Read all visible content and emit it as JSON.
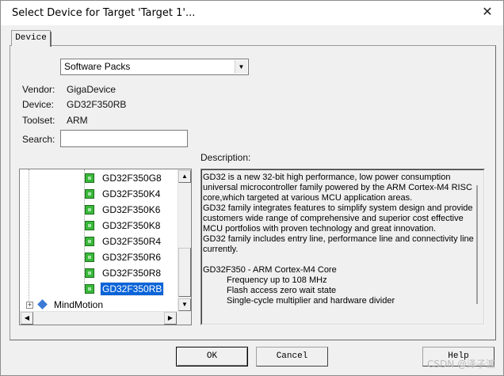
{
  "window": {
    "title": "Select Device for Target 'Target 1'...",
    "close_glyph": "✕"
  },
  "tabs": [
    {
      "label": "Device"
    }
  ],
  "source_select": {
    "value": "Software Packs"
  },
  "info": {
    "vendor_label": "Vendor:",
    "vendor_value": "GigaDevice",
    "device_label": "Device:",
    "device_value": "GD32F350RB",
    "toolset_label": "Toolset:",
    "toolset_value": "ARM",
    "search_label": "Search:",
    "search_value": ""
  },
  "description_label": "Description:",
  "tree": {
    "devices": [
      {
        "name": "GD32F350G8",
        "selected": false
      },
      {
        "name": "GD32F350K4",
        "selected": false
      },
      {
        "name": "GD32F350K6",
        "selected": false
      },
      {
        "name": "GD32F350K8",
        "selected": false
      },
      {
        "name": "GD32F350R4",
        "selected": false
      },
      {
        "name": "GD32F350R6",
        "selected": false
      },
      {
        "name": "GD32F350R8",
        "selected": false
      },
      {
        "name": "GD32F350RB",
        "selected": true
      }
    ],
    "next_vendor": "MindMotion",
    "expand_glyph": "+"
  },
  "description": {
    "lines": [
      "GD32 is a new 32-bit high performance, low power consumption",
      "universal microcontroller family powered by the ARM Cortex-M4 RISC",
      "core,which targeted at various MCU application areas.",
      "GD32 family integrates features to simplify system design and provide",
      "customers wide range of comprehensive and superior cost effective",
      "MCU portfolios with proven technology and great innovation.",
      "GD32 family includes entry line, performance line and connectivity line",
      "currently.",
      "",
      "GD32F350 - ARM Cortex-M4 Core"
    ],
    "indented_lines": [
      "Frequency up to 108 MHz",
      "Flash access zero wait state",
      "Single-cycle multiplier and hardware divider"
    ]
  },
  "buttons": {
    "ok": "OK",
    "cancel": "Cancel",
    "help": "Help"
  },
  "scroll": {
    "up": "▲",
    "down": "▼",
    "left": "◀",
    "right": "▶",
    "dropdown": "▼"
  },
  "watermark": "CSDN @泽子渡"
}
